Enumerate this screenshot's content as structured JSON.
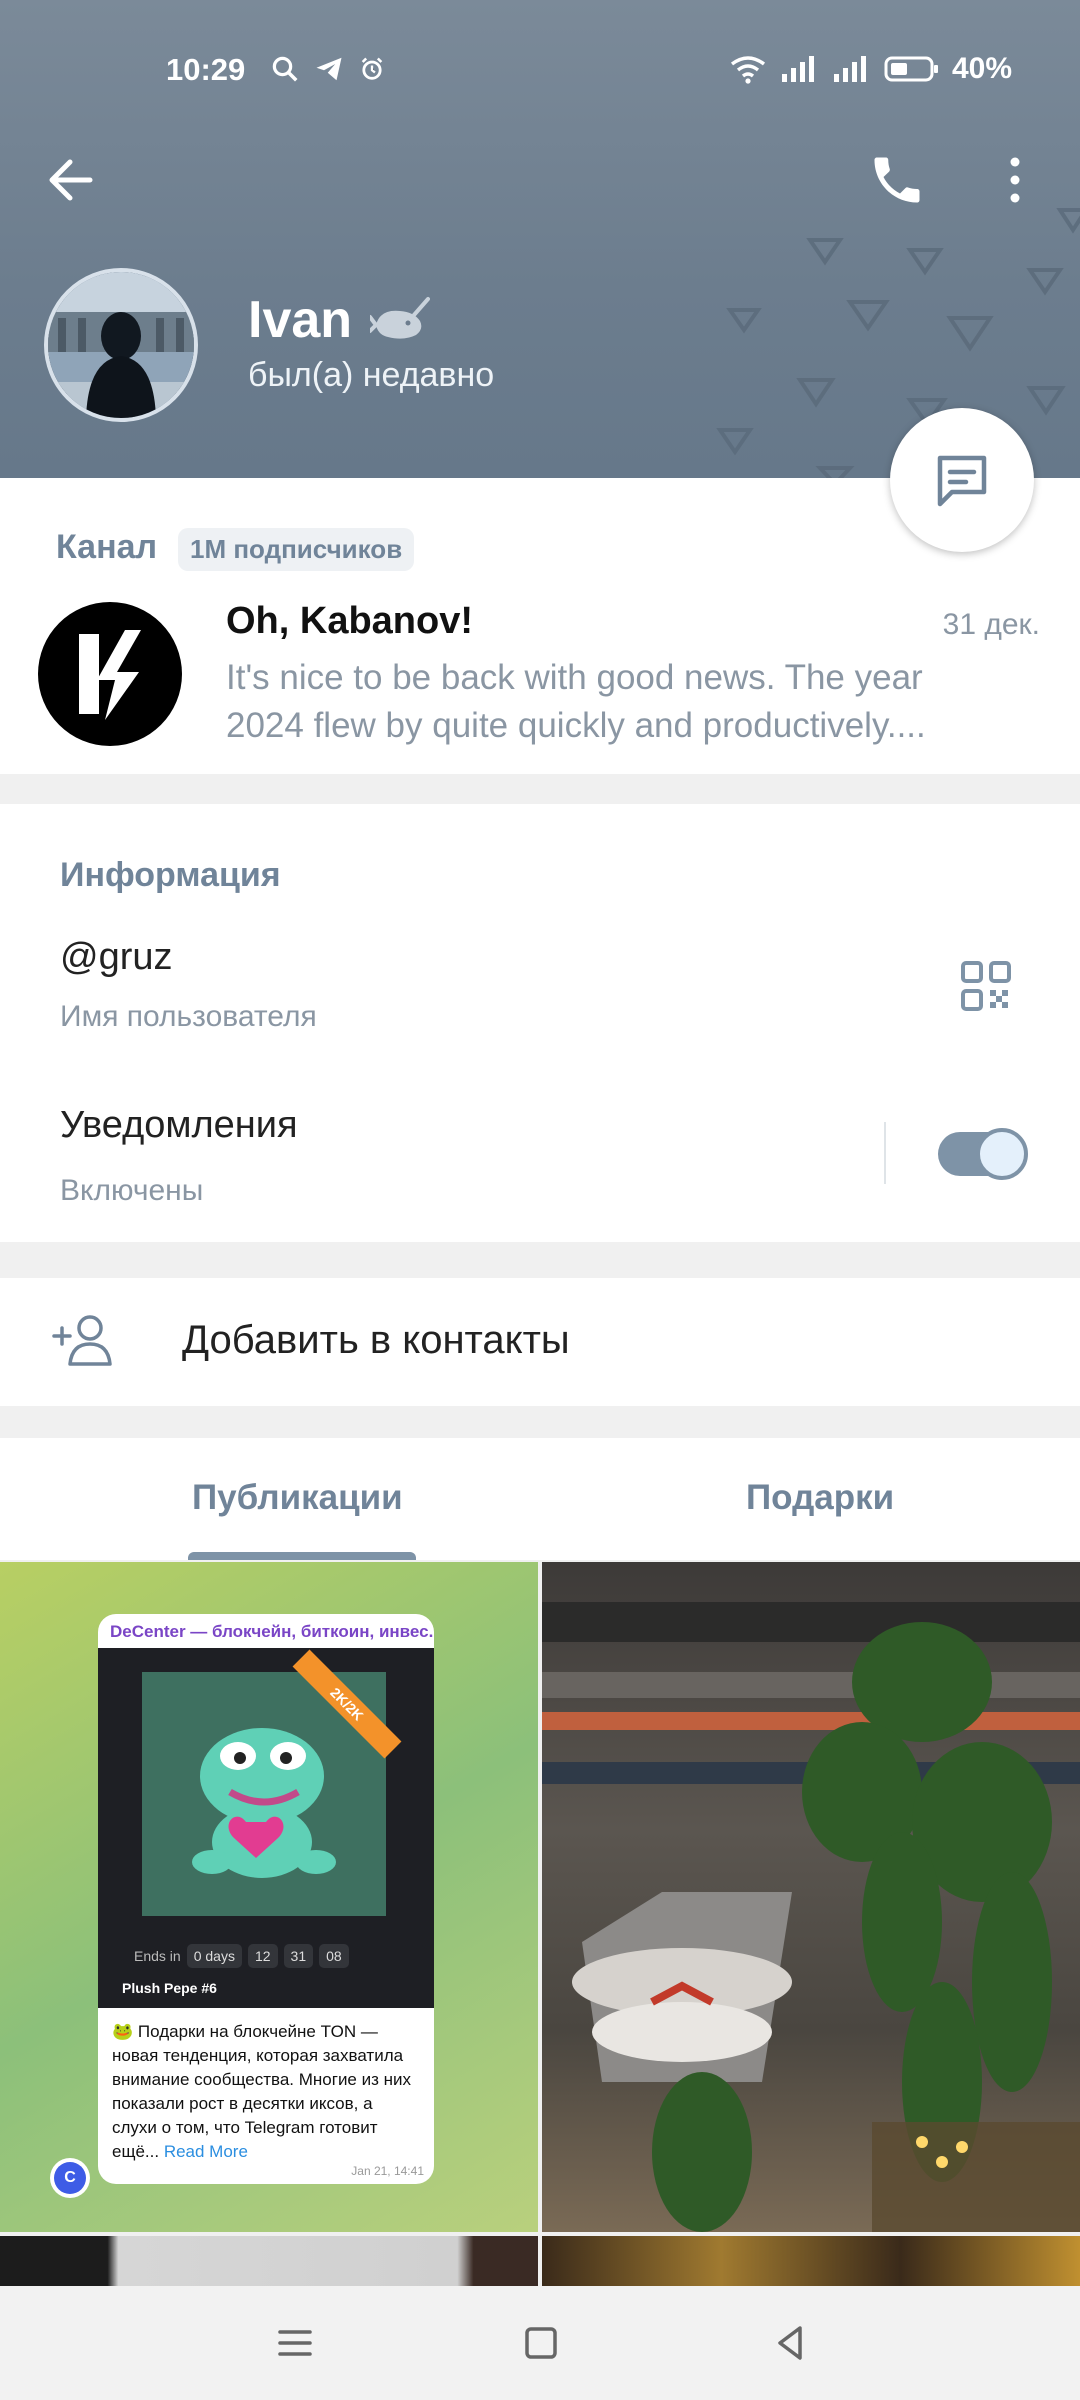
{
  "status_bar": {
    "time": "10:29",
    "battery": "40%"
  },
  "header": {
    "name": "Ivan",
    "status": "был(а) недавно"
  },
  "channel": {
    "label": "Канал",
    "subscribers": "1M подписчиков",
    "name": "Oh, Kabanov!",
    "date": "31 дек.",
    "message_line1": "It's nice to be back with good news. The year",
    "message_line2": "2024 flew by quite quickly and productively...."
  },
  "info": {
    "title": "Информация",
    "username": "@gruz",
    "username_label": "Имя пользователя",
    "notifications_title": "Уведомления",
    "notifications_value": "Включены",
    "notifications_enabled": true
  },
  "actions": {
    "add_contact": "Добавить в контакты"
  },
  "tabs": [
    {
      "label": "Публикации",
      "active": true
    },
    {
      "label": "Подарки",
      "active": false
    }
  ],
  "post": {
    "channel": "DeCenter — блокчейн, биткоин, инвес...",
    "ribbon": "2K/2K",
    "ends_in": "Ends in",
    "days": "0 days",
    "h": "12",
    "m": "31",
    "s": "08",
    "gift_name": "Plush Pepe #6",
    "text": "🐸 Подарки на блокчейне TON — новая тенденция, которая захватила внимание сообщества. Многие из них показали рост в десятки иксов, а слухи о том, что Telegram готовит ещё...",
    "read_more": "Read More",
    "date": "Jan 21, 14:41",
    "badge": "C"
  },
  "colors": {
    "header_bg": "#6c7d8e",
    "accent": "#708499",
    "toggle": "#7e93a7"
  }
}
